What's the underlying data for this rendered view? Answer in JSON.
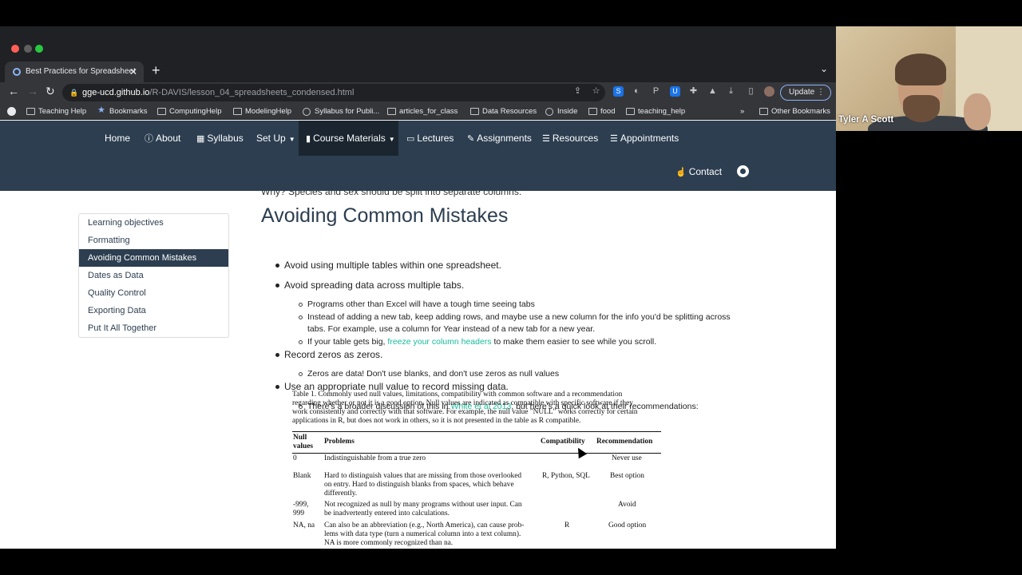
{
  "tab": {
    "title": "Best Practices for Spreadsheet",
    "close": "✕",
    "new_tab": "+"
  },
  "address": {
    "domain": "gge-ucd.github.io",
    "path": "/R-DAVIS/lesson_04_spreadsheets_condensed.html"
  },
  "toolbar": {
    "update_label": "Update",
    "update_menu": "⋮"
  },
  "bookmarks": [
    {
      "label": "Teaching Help",
      "icon": "folder-icon"
    },
    {
      "label": "Bookmarks",
      "icon": "star-icon"
    },
    {
      "label": "ComputingHelp",
      "icon": "folder-icon"
    },
    {
      "label": "ModelingHelp",
      "icon": "folder-icon"
    },
    {
      "label": "Syllabus for Publi...",
      "icon": "globe-icon"
    },
    {
      "label": "articles_for_class",
      "icon": "folder-icon"
    },
    {
      "label": "Data Resources",
      "icon": "folder-icon"
    },
    {
      "label": "Inside",
      "icon": "globe-icon"
    },
    {
      "label": "food",
      "icon": "folder-icon"
    },
    {
      "label": "teaching_help",
      "icon": "folder-icon"
    }
  ],
  "bookmarks_more": "»",
  "other_bookmarks": "Other Bookmarks",
  "nav": {
    "home": "Home",
    "about": "About",
    "syllabus": "Syllabus",
    "setup": "Set Up",
    "course_materials": "Course Materials",
    "lectures": "Lectures",
    "assignments": "Assignments",
    "resources": "Resources",
    "appointments": "Appointments",
    "contact": "Contact"
  },
  "toc": [
    "Learning objectives",
    "Formatting",
    "Avoiding Common Mistakes",
    "Dates as Data",
    "Quality Control",
    "Exporting Data",
    "Put It All Together"
  ],
  "toc_active_index": 2,
  "content": {
    "cutoff_line": "Why? Species and sex should be split into separate columns.",
    "heading": "Avoiding Common Mistakes",
    "b1": "Avoid using multiple tables within one spreadsheet.",
    "b2": "Avoid spreading data across multiple tabs.",
    "b2_s1": "Programs other than Excel will have a tough time seeing tabs",
    "b2_s2a": "Instead of adding a new tab, keep adding rows, and maybe use a new column for the info you'd be splitting across",
    "b2_s2b": "tabs. For example, use a column for Year instead of a new tab for a new year.",
    "b2_s3_pre": "If your table gets big, ",
    "b2_s3_link": "freeze your column headers",
    "b2_s3_post": " to make them easier to see while you scroll.",
    "b3": "Record zeros as zeros.",
    "b3_s1": "Zeros are data! Don't use blanks, and don't use zeros as null values",
    "b4": "Use an appropriate null value to record missing data.",
    "b4_s1_pre": "There's a broader discussion of this in ",
    "b4_s1_link": "White et al 2013",
    "b4_s1_post": ", but here's a quick look at their recommendations:"
  },
  "table_image": {
    "caption_1": "Table 1. Commonly used null values, limitations, compatibility with common software and a recommendation",
    "caption_2": "regarding whether or not it is a good option. Null values are indicated as compatible with specific software if they",
    "caption_3": "work consistently and correctly with that software. For example, the null value \"NULL\" works correctly for certain",
    "caption_4": "applications in R, but does not work in others, so it is not presented in the table as R compatible.",
    "headers": {
      "null_a": "Null",
      "null_b": "values",
      "problems": "Problems",
      "compat": "Compatibility",
      "rec": "Recommendation"
    },
    "rows": [
      {
        "v1": "0",
        "v2": "",
        "p1": "Indistinguishable from a true zero",
        "p2": "",
        "p3": "",
        "c": "",
        "r": "Never use"
      },
      {
        "v1": "Blank",
        "v2": "",
        "p1": "Hard to distinguish values that are missing from those overlooked",
        "p2": "on entry. Hard to distinguish blanks from spaces, which behave",
        "p3": "differently.",
        "c": "R, Python, SQL",
        "r": "Best option"
      },
      {
        "v1": "-999,",
        "v2": "999",
        "p1": "Not recognized as null by many programs without user input. Can",
        "p2": "be inadvertently entered into calculations.",
        "p3": "",
        "c": "",
        "r": "Avoid"
      },
      {
        "v1": "NA, na",
        "v2": "",
        "p1": "Can also be an abbreviation (e.g., North America), can cause prob-",
        "p2": "lems with data type (turn a numerical column into a text column).",
        "p3": "NA is more commonly recognized than na.",
        "c": "R",
        "r": "Good option"
      }
    ]
  },
  "webcam": {
    "name": "Tyler A Scott"
  }
}
